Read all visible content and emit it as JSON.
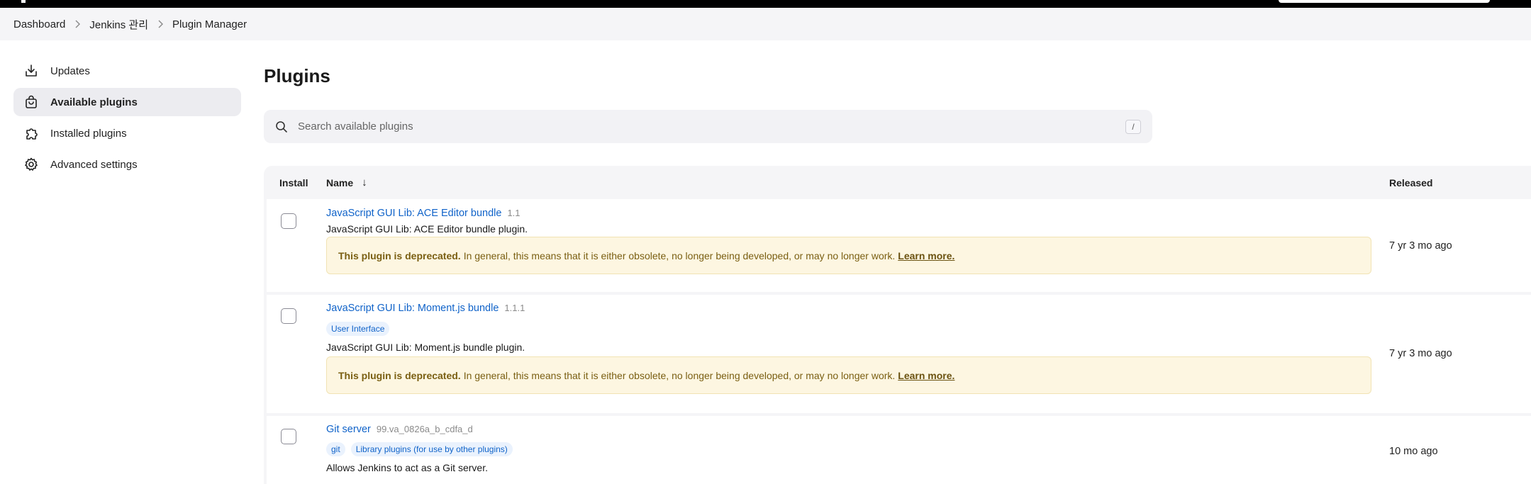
{
  "breadcrumb": {
    "items": [
      "Dashboard",
      "Jenkins 관리",
      "Plugin Manager"
    ]
  },
  "sidebar": {
    "items": [
      {
        "label": "Updates",
        "icon": "download-icon"
      },
      {
        "label": "Available plugins",
        "icon": "shopping-bag-icon",
        "active": true
      },
      {
        "label": "Installed plugins",
        "icon": "puzzle-icon"
      },
      {
        "label": "Advanced settings",
        "icon": "gear-icon"
      }
    ]
  },
  "main": {
    "title": "Plugins",
    "search": {
      "placeholder": "Search available plugins",
      "shortcut": "/"
    },
    "table": {
      "headers": {
        "install": "Install",
        "name": "Name",
        "sort_indicator": "↓",
        "released": "Released"
      },
      "rows": [
        {
          "name": "JavaScript GUI Lib: ACE Editor bundle",
          "version": "1.1",
          "tags": [],
          "description": "JavaScript GUI Lib: ACE Editor bundle plugin.",
          "deprecated": {
            "strong": "This plugin is deprecated.",
            "text": "In general, this means that it is either obsolete, no longer being developed, or may no longer work.",
            "link": "Learn more."
          },
          "released": "7 yr 3 mo ago"
        },
        {
          "name": "JavaScript GUI Lib: Moment.js bundle",
          "version": "1.1.1",
          "tags": [
            "User Interface"
          ],
          "description": "JavaScript GUI Lib: Moment.js bundle plugin.",
          "deprecated": {
            "strong": "This plugin is deprecated.",
            "text": "In general, this means that it is either obsolete, no longer being developed, or may no longer work.",
            "link": "Learn more."
          },
          "released": "7 yr 3 mo ago"
        },
        {
          "name": "Git server",
          "version": "99.va_0826a_b_cdfa_d",
          "tags": [
            "git",
            "Library plugins (for use by other plugins)"
          ],
          "description": "Allows Jenkins to act as a Git server.",
          "released": "10 mo ago"
        }
      ]
    }
  },
  "colors": {
    "link": "#1063c9",
    "deprecated_bg": "#fdf6e1",
    "deprecated_text": "#7a5f12",
    "active_nav_bg": "#ececf0"
  }
}
